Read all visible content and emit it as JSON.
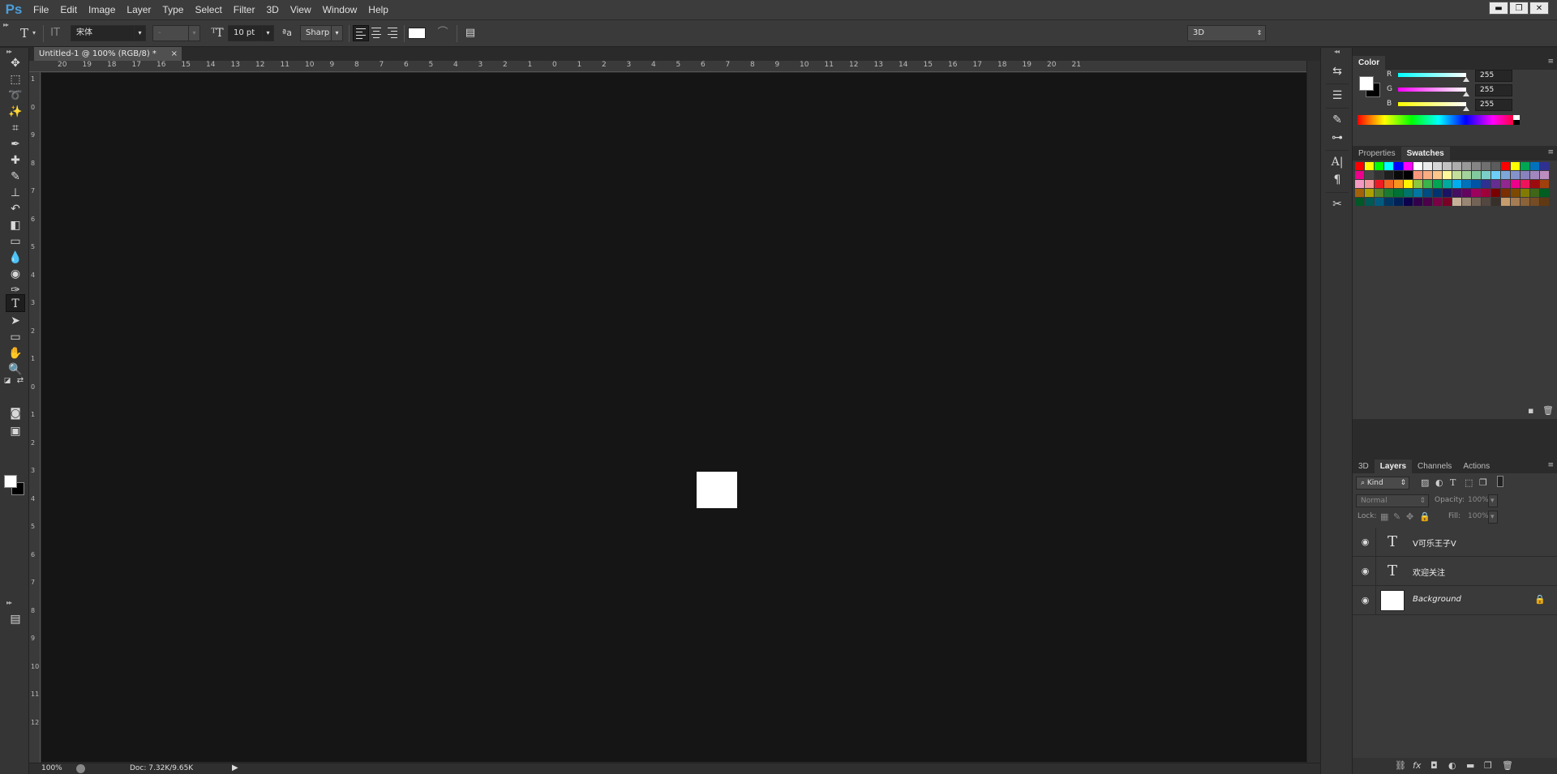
{
  "app": {
    "logo": "Ps",
    "menu": [
      "File",
      "Edit",
      "Image",
      "Layer",
      "Type",
      "Select",
      "Filter",
      "3D",
      "View",
      "Window",
      "Help"
    ],
    "window_controls": [
      "▬",
      "❐",
      "✕"
    ]
  },
  "options_bar": {
    "tool_glyph": "T",
    "font_family": "宋体",
    "font_style": "-",
    "font_size": "10 pt",
    "antialias_glyph": "ªa",
    "antialias": "Sharp",
    "workspace": "3D",
    "text_color": "#ffffff"
  },
  "document": {
    "tab_title": "Untitled-1 @ 100% (RGB/8) *",
    "tab_close": "×",
    "ruler_h_labels": [
      "20",
      "19",
      "18",
      "17",
      "16",
      "15",
      "14",
      "13",
      "12",
      "11",
      "10",
      "9",
      "8",
      "7",
      "6",
      "5",
      "4",
      "3",
      "2",
      "1",
      "0",
      "1",
      "2",
      "3",
      "4",
      "5",
      "6",
      "7",
      "8",
      "9",
      "10",
      "11",
      "12",
      "13",
      "14",
      "15",
      "16",
      "17",
      "18",
      "19",
      "20",
      "21"
    ],
    "ruler_v_labels": [
      "1",
      "0",
      "9",
      "8",
      "7",
      "6",
      "5",
      "4",
      "3",
      "2",
      "1",
      "0",
      "1",
      "2",
      "3",
      "4",
      "5",
      "6",
      "7",
      "8",
      "9",
      "10",
      "11",
      "12"
    ]
  },
  "status": {
    "zoom": "100%",
    "doc_size": "Doc: 7.32K/9.65K",
    "arrow": "▶"
  },
  "color_panel": {
    "tab": "Color",
    "channels": [
      {
        "label": "R",
        "value": "255",
        "gradient": "linear-gradient(to right, #00ffff, #ffffff)"
      },
      {
        "label": "G",
        "value": "255",
        "gradient": "linear-gradient(to right, #ff00ff, #ffffff)"
      },
      {
        "label": "B",
        "value": "255",
        "gradient": "linear-gradient(to right, #ffff00, #ffffff)"
      }
    ]
  },
  "swatches_panel": {
    "tabs": [
      "Properties",
      "Swatches"
    ],
    "active_tab": "Swatches",
    "colors": [
      "#ff0000",
      "#ffff00",
      "#00ff00",
      "#00ffff",
      "#0000ff",
      "#ff00ff",
      "#ffffff",
      "#ebebeb",
      "#d6d6d6",
      "#c2c2c2",
      "#adadad",
      "#999999",
      "#858585",
      "#707070",
      "#5c5c5c",
      "#ff0000",
      "#ffff00",
      "#00a651",
      "#0072bc",
      "#2e3192",
      "#ec008c",
      "#474747",
      "#333333",
      "#1f1f1f",
      "#0a0a0a",
      "#000000",
      "#f7977a",
      "#f9ad81",
      "#fdc68a",
      "#fff79a",
      "#c4df9b",
      "#a3d39c",
      "#82ca9d",
      "#7bcdc8",
      "#6ecff6",
      "#7ea7d8",
      "#8493ca",
      "#8882be",
      "#a187be",
      "#bc8dbf",
      "#f49ac2",
      "#f6989d",
      "#ed1c24",
      "#f26522",
      "#f7941d",
      "#fff200",
      "#8dc63f",
      "#39b54a",
      "#00a651",
      "#00a99d",
      "#00aeef",
      "#0072bc",
      "#0054a6",
      "#2e3192",
      "#662d91",
      "#92278f",
      "#ec008c",
      "#ed145b",
      "#9e0b0f",
      "#a0410d",
      "#a36209",
      "#aba000",
      "#598527",
      "#197b30",
      "#007236",
      "#00746b",
      "#0076a3",
      "#004b80",
      "#003471",
      "#1b1464",
      "#440e62",
      "#630460",
      "#9e005d",
      "#9e0039",
      "#790000",
      "#7b2e00",
      "#7d4900",
      "#827b00",
      "#406618",
      "#005e20",
      "#005826",
      "#005952",
      "#005b7f",
      "#003663",
      "#002157",
      "#0d004c",
      "#32004b",
      "#4b0049",
      "#7b0046",
      "#7a0026",
      "#c7b299",
      "#998675",
      "#736357",
      "#534741",
      "#37302a",
      "#c69c6d",
      "#a67c52",
      "#8c6239",
      "#754c24",
      "#603913"
    ]
  },
  "layers_panel": {
    "tabs": [
      "3D",
      "Layers",
      "Channels",
      "Actions"
    ],
    "active_tab": "Layers",
    "filter_kind": "Kind",
    "blend_mode": "Normal",
    "opacity_label": "Opacity:",
    "opacity_value": "100%",
    "lock_label": "Lock:",
    "fill_label": "Fill:",
    "fill_value": "100%",
    "layers": [
      {
        "name": "V可乐王子V",
        "type": "text",
        "glyph": "T"
      },
      {
        "name": "欢迎关注",
        "type": "text",
        "glyph": "T"
      },
      {
        "name": "Background",
        "type": "image",
        "locked": true
      }
    ]
  }
}
